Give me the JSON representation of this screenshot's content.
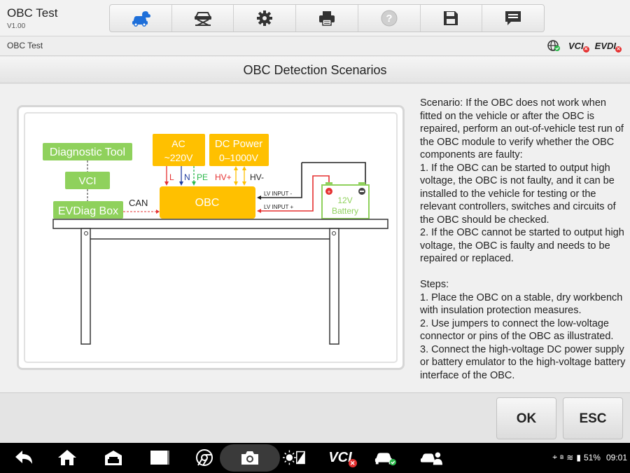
{
  "app": {
    "title": "OBC Test",
    "version": "V1.00"
  },
  "toolbar": {
    "buttons": [
      {
        "name": "vehicle-cloud-icon",
        "active": true
      },
      {
        "name": "vehicle-lift-icon"
      },
      {
        "name": "gear-icon"
      },
      {
        "name": "printer-icon"
      },
      {
        "name": "help-icon",
        "disabled": true
      },
      {
        "name": "save-icon"
      },
      {
        "name": "message-icon"
      }
    ]
  },
  "breadcrumb": "OBC Test",
  "status": {
    "vci": "VCI",
    "evdiag": "EVDI"
  },
  "section_title": "OBC Detection Scenarios",
  "diagram": {
    "diag_tool": "Diagnostic Tool",
    "vci": "VCI",
    "evdiag_box": "EVDiag Box",
    "can": "CAN",
    "ac_line1": "AC",
    "ac_line2": "~220V",
    "dc_line1": "DC Power",
    "dc_line2": "0–1000V",
    "obc": "OBC",
    "l": "L",
    "n": "N",
    "pe": "PE",
    "hv_plus": "HV+",
    "hv_minus": "HV-",
    "lv_minus": "LV INPUT -",
    "lv_plus": "LV INPUT +",
    "bat_line1": "12V",
    "bat_line2": "Battery"
  },
  "description": {
    "scenario": "Scenario: If the OBC does not work when fitted on the vehicle or after the OBC is repaired, perform an out-of-vehicle test run of the OBC module to verify whether the OBC components are faulty:",
    "point1": "1. If the OBC can be started to output high voltage, the OBC is not faulty, and it can be installed to the vehicle for testing or the relevant controllers, switches and circuits of the OBC should be checked.",
    "point2": "2. If the OBC cannot be started to output high voltage, the OBC is faulty and needs to be repaired or replaced.",
    "steps_title": "Steps:",
    "step1": "1. Place the OBC on a stable, dry workbench with insulation protection measures.",
    "step2": "2. Use jumpers to connect the low-voltage connector or pins of the OBC as illustrated.",
    "step3": "3. Connect the high-voltage DC power supply or battery emulator to the high-voltage battery interface of the OBC."
  },
  "footer": {
    "ok": "OK",
    "esc": "ESC"
  },
  "system": {
    "battery": "51%",
    "time": "09:01",
    "vci": "VCI"
  },
  "colors": {
    "accent_orange": "#ffc000",
    "accent_green": "#8fd15c",
    "status_red": "#e53030",
    "status_green": "#2db84c"
  }
}
